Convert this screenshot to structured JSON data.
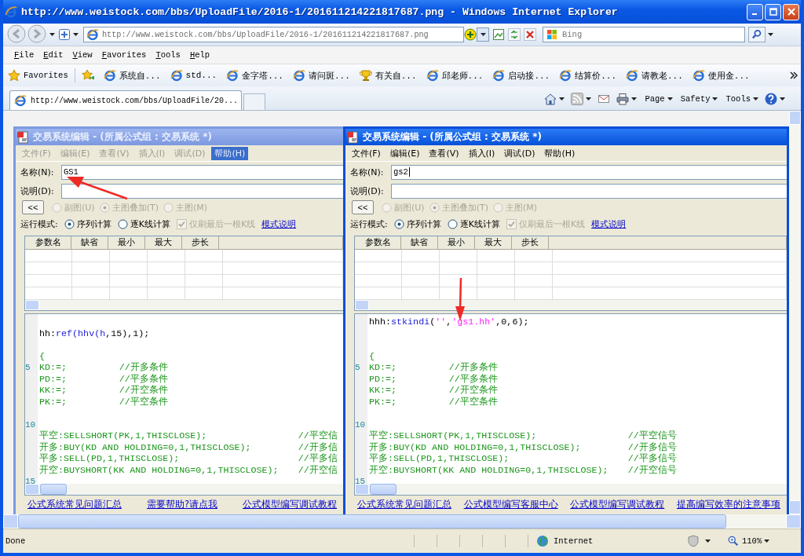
{
  "window": {
    "title": "http://www.weistock.com/bbs/UploadFile/2016-1/201611214221817687.png - Windows Internet Explorer"
  },
  "address_bar": {
    "url": "http://www.weistock.com/bbs/UploadFile/2016-1/201611214221817687.png"
  },
  "search": {
    "placeholder": "Bing"
  },
  "menu": [
    "File",
    "Edit",
    "View",
    "Favorites",
    "Tools",
    "Help"
  ],
  "favorites_bar": {
    "label": "Favorites",
    "items": [
      {
        "label": "系统自...",
        "kind": "page"
      },
      {
        "label": "std...",
        "kind": "page"
      },
      {
        "label": "金字塔...",
        "kind": "page"
      },
      {
        "label": "请问斑...",
        "kind": "page"
      },
      {
        "label": "有关自...",
        "kind": "trophy"
      },
      {
        "label": "邱老师...",
        "kind": "page"
      },
      {
        "label": "启动接...",
        "kind": "page"
      },
      {
        "label": "结算价...",
        "kind": "page"
      },
      {
        "label": "请教老...",
        "kind": "page"
      },
      {
        "label": "使用金...",
        "kind": "page"
      }
    ]
  },
  "tabs": [
    {
      "label": "http://www.weistock.com/bbs/UploadFile/20...",
      "selected": true
    }
  ],
  "command_bar": [
    "Page",
    "Safety",
    "Tools"
  ],
  "editors": [
    {
      "active": false,
      "title": "交易系统编辑 - (所属公式组 : 交易系统 *)",
      "menu": [
        {
          "label": "文件(F)",
          "highlighted": false
        },
        {
          "label": "编辑(E)",
          "highlighted": false
        },
        {
          "label": "查看(V)",
          "highlighted": false
        },
        {
          "label": "插入(I)",
          "highlighted": false
        },
        {
          "label": "调试(D)",
          "highlighted": false
        },
        {
          "label": "帮助(H)",
          "highlighted": true
        }
      ],
      "name_label": "名称(N):",
      "name_value": "GS1",
      "desc_label": "说明(D):",
      "collapse_button": "<<",
      "chart_options": [
        {
          "label": "副图(U)",
          "selected": false,
          "disabled": true
        },
        {
          "label": "主图叠加(T)",
          "selected": true,
          "disabled": true
        },
        {
          "label": "主图(M)",
          "selected": false,
          "disabled": true
        }
      ],
      "run_mode": {
        "label": "运行模式:",
        "options": [
          {
            "label": "序列计算",
            "selected": true
          },
          {
            "label": "逐K线计算",
            "selected": false
          }
        ],
        "checkbox": {
          "label": "仅刷最后一根K线",
          "checked": true,
          "disabled": true
        },
        "link": "模式说明"
      },
      "param_columns": [
        "参数名",
        "缺省",
        "最小",
        "最大",
        "步长"
      ],
      "code_lines": [
        {
          "kind": "blank"
        },
        {
          "kind": "code",
          "segments": [
            {
              "text": "hh:",
              "kind": "plain"
            },
            {
              "text": "ref(hhv(h",
              "kind": "function"
            },
            {
              "text": ",15),1);",
              "kind": "plain"
            }
          ]
        },
        {
          "kind": "blank"
        },
        {
          "kind": "code",
          "segments": [
            {
              "text": "{",
              "kind": "statement"
            }
          ]
        },
        {
          "kind": "code",
          "number": "5",
          "segments": [
            {
              "text": "KD:=;",
              "kind": "statement"
            }
          ],
          "comment": "//开多条件"
        },
        {
          "kind": "code",
          "segments": [
            {
              "text": "PD:=;",
              "kind": "statement"
            }
          ],
          "comment": "//平多条件"
        },
        {
          "kind": "code",
          "segments": [
            {
              "text": "KK:=;",
              "kind": "statement"
            }
          ],
          "comment": "//开空条件"
        },
        {
          "kind": "code",
          "segments": [
            {
              "text": "PK:=;",
              "kind": "statement"
            }
          ],
          "comment": "//平空条件"
        },
        {
          "kind": "blank"
        },
        {
          "kind": "blank",
          "number": "10"
        },
        {
          "kind": "code",
          "segments": [
            {
              "text": "平空:SELLSHORT(PK,1,THISCLOSE);",
              "kind": "statement"
            }
          ],
          "comment": "//平空信"
        },
        {
          "kind": "code",
          "segments": [
            {
              "text": "开多:BUY(KD AND HOLDING=0,1,THISCLOSE);",
              "kind": "statement"
            }
          ],
          "comment": "//开多信"
        },
        {
          "kind": "code",
          "segments": [
            {
              "text": "平多:SELL(PD,1,THISCLOSE);",
              "kind": "statement"
            }
          ],
          "comment": "//平多信"
        },
        {
          "kind": "code",
          "segments": [
            {
              "text": "开空:BUYSHORT(KK AND HOLDING=0,1,THISCLOSE);",
              "kind": "statement"
            }
          ],
          "comment": "//开空信"
        },
        {
          "kind": "blank",
          "number": "15"
        }
      ],
      "links": [
        "公式系统常见问题汇总",
        "需要帮助?请点我",
        "公式模型编写调试教程"
      ]
    },
    {
      "active": true,
      "title": "交易系统编辑 - (所属公式组 : 交易系统 *)",
      "menu": [
        {
          "label": "文件(F)",
          "highlighted": false
        },
        {
          "label": "编辑(E)",
          "highlighted": false
        },
        {
          "label": "查看(V)",
          "highlighted": false
        },
        {
          "label": "插入(I)",
          "highlighted": false
        },
        {
          "label": "调试(D)",
          "highlighted": false
        },
        {
          "label": "帮助(H)",
          "highlighted": false
        }
      ],
      "name_label": "名称(N):",
      "name_value": "gs2",
      "desc_label": "说明(D):",
      "collapse_button": "<<",
      "chart_options": [
        {
          "label": "副图(U)",
          "selected": false,
          "disabled": true
        },
        {
          "label": "主图叠加(T)",
          "selected": true,
          "disabled": true
        },
        {
          "label": "主图(M)",
          "selected": false,
          "disabled": true
        }
      ],
      "run_mode": {
        "label": "运行模式:",
        "options": [
          {
            "label": "序列计算",
            "selected": true
          },
          {
            "label": "逐K线计算",
            "selected": false
          }
        ],
        "checkbox": {
          "label": "仅刷最后一根K线",
          "checked": true,
          "disabled": true
        },
        "link": "模式说明"
      },
      "param_columns": [
        "参数名",
        "缺省",
        "最小",
        "最大",
        "步长"
      ],
      "code_lines": [
        {
          "kind": "code",
          "segments": [
            {
              "text": "hhh:",
              "kind": "plain"
            },
            {
              "text": "stkindi",
              "kind": "function"
            },
            {
              "text": "(",
              "kind": "plain"
            },
            {
              "text": "''",
              "kind": "string"
            },
            {
              "text": ",",
              "kind": "plain"
            },
            {
              "text": "'gs1.hh'",
              "kind": "string"
            },
            {
              "text": ",0,6);",
              "kind": "plain"
            }
          ]
        },
        {
          "kind": "blank"
        },
        {
          "kind": "blank"
        },
        {
          "kind": "code",
          "segments": [
            {
              "text": "{",
              "kind": "statement"
            }
          ]
        },
        {
          "kind": "code",
          "number": "5",
          "segments": [
            {
              "text": "KD:=;",
              "kind": "statement"
            }
          ],
          "comment": "//开多条件"
        },
        {
          "kind": "code",
          "segments": [
            {
              "text": "PD:=;",
              "kind": "statement"
            }
          ],
          "comment": "//平多条件"
        },
        {
          "kind": "code",
          "segments": [
            {
              "text": "KK:=;",
              "kind": "statement"
            }
          ],
          "comment": "//开空条件"
        },
        {
          "kind": "code",
          "segments": [
            {
              "text": "PK:=;",
              "kind": "statement"
            }
          ],
          "comment": "//平空条件"
        },
        {
          "kind": "blank"
        },
        {
          "kind": "blank",
          "number": "10"
        },
        {
          "kind": "code",
          "segments": [
            {
              "text": "平空:SELLSHORT(PK,1,THISCLOSE);",
              "kind": "statement"
            }
          ],
          "comment": "//平空信号"
        },
        {
          "kind": "code",
          "segments": [
            {
              "text": "开多:BUY(KD AND HOLDING=0,1,THISCLOSE);",
              "kind": "statement"
            }
          ],
          "comment": "//开多信号"
        },
        {
          "kind": "code",
          "segments": [
            {
              "text": "平多:SELL(PD,1,THISCLOSE);",
              "kind": "statement"
            }
          ],
          "comment": "//平多信号"
        },
        {
          "kind": "code",
          "segments": [
            {
              "text": "开空:BUYSHORT(KK AND HOLDING=0,1,THISCLOSE);",
              "kind": "statement"
            }
          ],
          "comment": "//开空信号"
        },
        {
          "kind": "blank",
          "number": "15"
        }
      ],
      "links": [
        "公式系统常见问题汇总",
        "公式模型编写客服中心",
        "公式模型编写调试教程",
        "提高编写效率的注意事项"
      ]
    }
  ],
  "status_bar": {
    "text": "Done",
    "zone": "Internet",
    "zoom": "110%"
  }
}
